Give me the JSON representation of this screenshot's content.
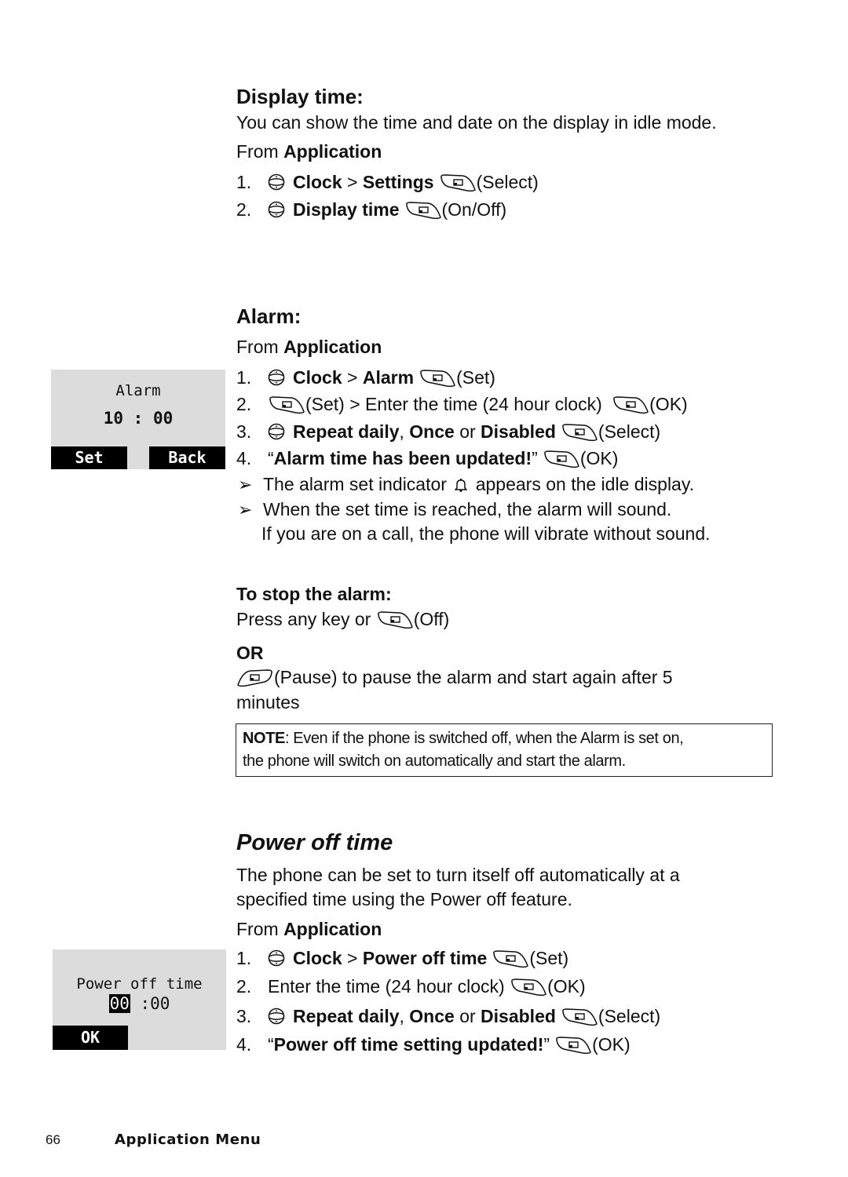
{
  "display_time": {
    "heading": "Display time:",
    "intro": "You can show the time and date on the display in idle mode.",
    "from_prefix": "From ",
    "from_menu": "Application",
    "steps": [
      {
        "num": "1.",
        "a": "Clock",
        "sep": " > ",
        "b": "Settings",
        "key_action": "(Select)"
      },
      {
        "num": "2.",
        "a": "Display time",
        "key_action": "(On/Off)"
      }
    ]
  },
  "alarm": {
    "heading": "Alarm:",
    "from_prefix": "From ",
    "from_menu": "Application",
    "steps": [
      {
        "num": "1.",
        "a": "Clock",
        "sep": " > ",
        "b": "Alarm",
        "key_action": "(Set)"
      },
      {
        "num": "2.",
        "key_action": "(Set)",
        "rest": " > Enter the time (24 hour clock) ",
        "key_action2": "(OK)"
      },
      {
        "num": "3.",
        "a": "Repeat daily",
        "c1": ", ",
        "b": "Once",
        "c2": " or ",
        "c": "Disabled",
        "key_action": "(Select)"
      },
      {
        "num": "4.",
        "q_open": "“",
        "a": "Alarm time has been updated!",
        "q_close": "”",
        "key_action": "(OK)"
      }
    ],
    "notes": [
      {
        "before": "The alarm set indicator ",
        "after": " appears on the idle display."
      },
      {
        "text": "When the set time is reached, the alarm will sound.",
        "cont": "If you are on a call, the phone will vibrate without sound."
      }
    ],
    "stop": {
      "heading": "To stop the alarm:",
      "line1": "Press any key or ",
      "line1_action": "(Off)",
      "or": "OR",
      "pause_action": "(Pause) to pause the alarm and start again after 5",
      "pause_cont": "minutes"
    },
    "note_box": {
      "label": "NOTE",
      "line1": ": Even if the phone is switched off, when the Alarm is set on,",
      "line2": "the phone will switch on automatically and start the alarm."
    },
    "screen": {
      "title": "Alarm",
      "time": "10 : 00",
      "left_soft": "Set",
      "right_soft": "Back"
    }
  },
  "power_off": {
    "heading": "Power off time",
    "intro1": "The phone can be set to turn itself off automatically at a",
    "intro2": "specified time using the Power off feature.",
    "from_prefix": "From ",
    "from_menu": "Application",
    "steps": [
      {
        "num": "1.",
        "a": "Clock",
        "sep": " > ",
        "b": "Power off time",
        "key_action": "(Set)"
      },
      {
        "num": "2.",
        "text": "Enter the time (24 hour clock) ",
        "key_action": "(OK)"
      },
      {
        "num": "3.",
        "a": "Repeat daily",
        "c1": ", ",
        "b": "Once",
        "c2": " or ",
        "c": "Disabled",
        "key_action": "(Select)"
      },
      {
        "num": "4.",
        "q_open": "“",
        "a": "Power off time setting updated!",
        "q_close": "”",
        "key_action": "(OK)"
      }
    ],
    "screen": {
      "title": "Power off time",
      "hours": "00",
      "rest": " :00",
      "left_soft": "OK"
    }
  },
  "footer": {
    "page_number": "66",
    "section": "Application Menu"
  },
  "icons": {
    "nav": "nav-key-icon",
    "soft_right": "right-softkey-icon",
    "soft_left": "left-softkey-icon",
    "bell": "bell-icon",
    "bullet": "➢"
  }
}
